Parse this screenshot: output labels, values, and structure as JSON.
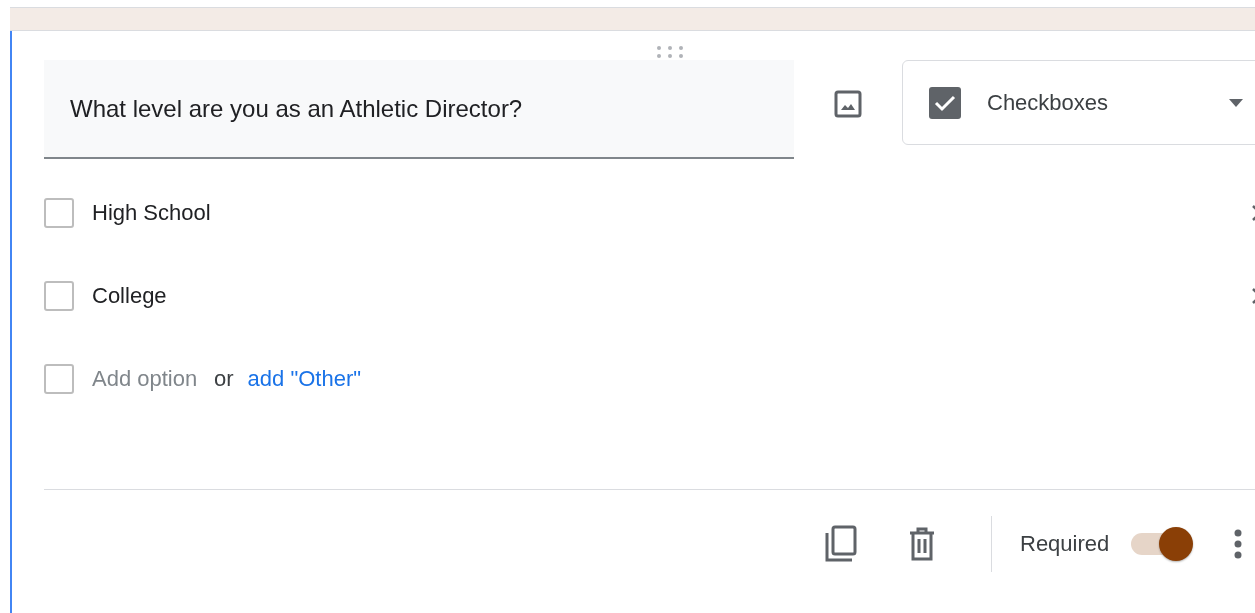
{
  "question": {
    "value": "What level are you as an Athletic Director?"
  },
  "type_dropdown": {
    "label": "Checkboxes"
  },
  "options": [
    {
      "label": "High School",
      "checked": false
    },
    {
      "label": "College",
      "checked": false
    }
  ],
  "add_option": {
    "checked": false,
    "placeholder": "Add option",
    "or": "or",
    "other_link": "add \"Other\""
  },
  "footer": {
    "required_label": "Required",
    "required": true
  }
}
